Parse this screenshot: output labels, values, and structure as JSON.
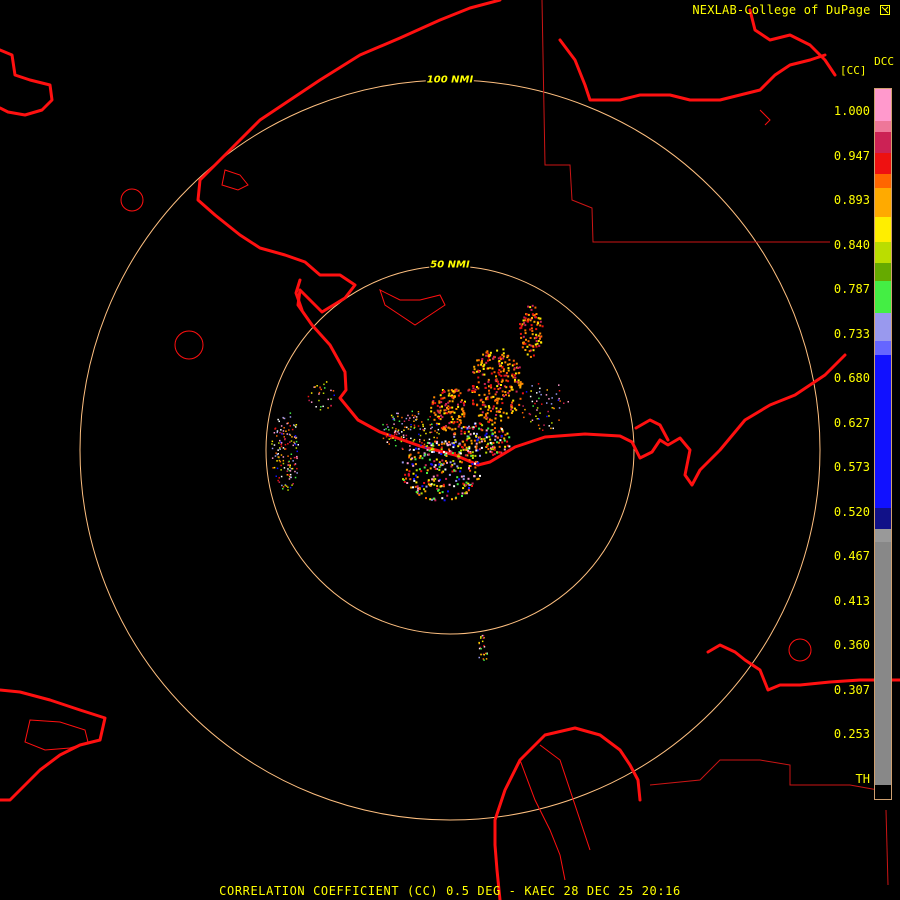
{
  "header": {
    "credit": "NEXLAB-College of DuPage",
    "product_tag": "DCC",
    "product_unit": "[CC]"
  },
  "footer": {
    "caption": "CORRELATION COEFFICIENT (CC) 0.5 DEG - KAEC 28 DEC 25 20:16"
  },
  "rings": [
    {
      "label": "100 NMI"
    },
    {
      "label": "50 NMI"
    }
  ],
  "colorbar": {
    "ticks": [
      "1.000",
      "0.947",
      "0.893",
      "0.840",
      "0.787",
      "0.733",
      "0.680",
      "0.627",
      "0.573",
      "0.520",
      "0.467",
      "0.413",
      "0.360",
      "0.307",
      "0.253",
      "TH"
    ],
    "colors": {
      "pink_light": "#ff99cc",
      "pink": "#ee7799",
      "magenta_red": "#cc2255",
      "red": "#ee1111",
      "orange": "#ff6600",
      "orange_yellow": "#ffaa00",
      "yellow": "#ffee00",
      "yellow_green": "#bbdd00",
      "green_dark": "#66aa00",
      "green": "#44ee44",
      "lavender": "#9999ee",
      "blue_light": "#6666ff",
      "blue": "#1111ff",
      "navy": "#111188",
      "gray_light": "#999999",
      "gray": "#888888",
      "black": "#000000"
    }
  },
  "map_colors": {
    "coast": "#ff1010",
    "border": "#cc1515",
    "ring": "#ffc080"
  }
}
